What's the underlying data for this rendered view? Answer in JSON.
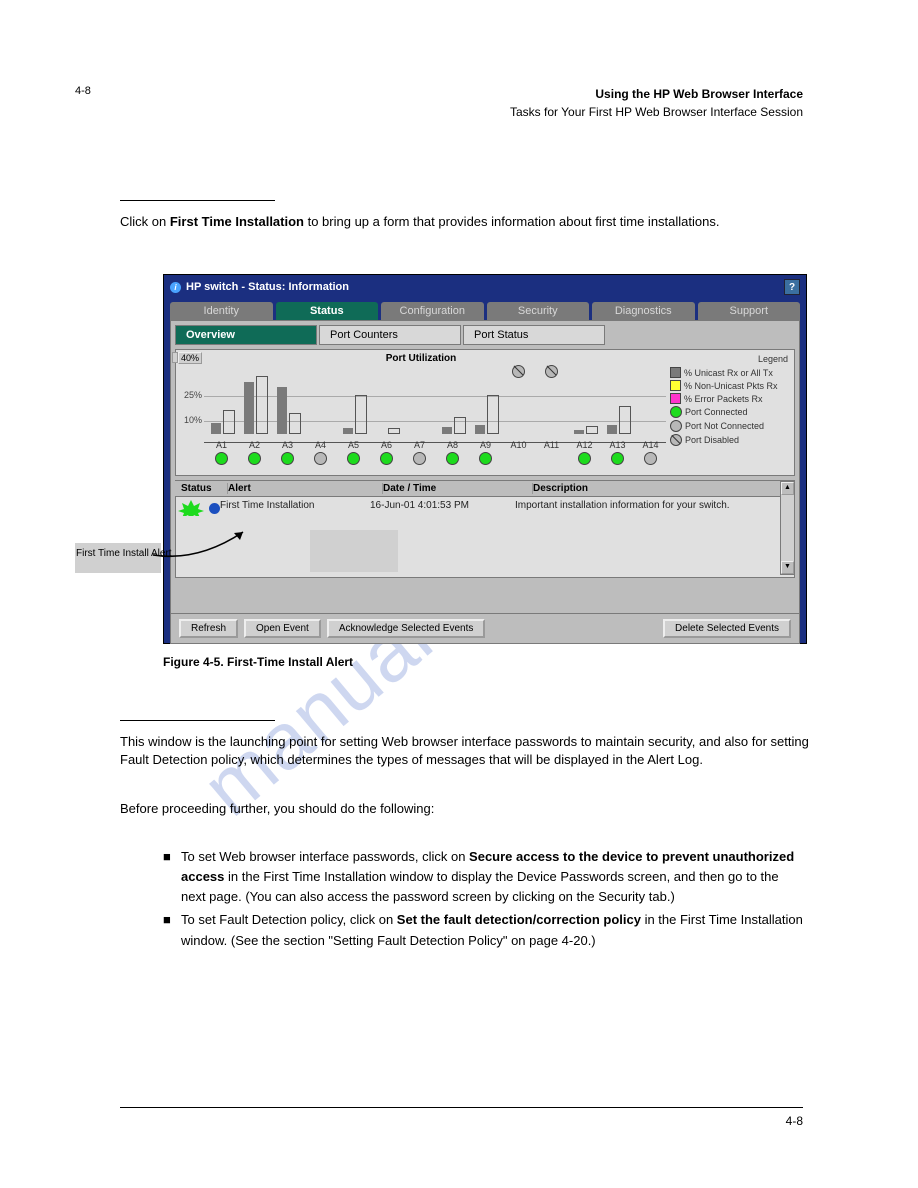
{
  "page": {
    "top_number": "4-8",
    "header_title": "Using the HP Web Browser Interface",
    "header_subtitle": "Tasks for Your First HP Web Browser Interface Session",
    "watermark": "manualshive.com"
  },
  "body": {
    "intro_pre": "Click on ",
    "intro_bold": "First Time Installation",
    "intro_post": " to bring up a form that provides information about first time installations.",
    "text2_pre": "This window is the launching point for setting Web browser interface passwords to maintain security, and also for setting Fault Detection policy, which determines the types of messages that will be displayed in the ",
    "text2_link": "Alert Log",
    "text2_post": ".",
    "text3_pre": "Before proceeding further, you should do the following:",
    "bullets": [
      {
        "prefix": "To set Web browser interface passwords, click on ",
        "bold": "Secure access to the device to prevent unauthorized access",
        "suffix": " in the First Time Installation window to display the Device Passwords screen, and then go to the next page. (You can also access the password screen by clicking on the Security tab.)"
      },
      {
        "prefix": "To set Fault Detection policy, click on ",
        "bold": "Set the fault detection/correction policy",
        "suffix": " in the First Time Installation window. (See the section \"Setting Fault Detection Policy\" on page 4-20.)"
      }
    ]
  },
  "callouts": {
    "first_time": "First Time Install Alert"
  },
  "figure": {
    "caption": "Figure 4-5. First-Time Install Alert"
  },
  "footer": {
    "page_num": "4-8"
  },
  "app": {
    "window_title": "HP switch - Status: Information",
    "tabs": [
      "Identity",
      "Status",
      "Configuration",
      "Security",
      "Diagnostics",
      "Support"
    ],
    "active_tab": 1,
    "sub_tabs": [
      "Overview",
      "Port Counters",
      "Port Status"
    ],
    "active_sub_tab": 0,
    "buttons": {
      "refresh": "Refresh",
      "open_event": "Open Event",
      "ack": "Acknowledge Selected Events",
      "delete": "Delete Selected Events"
    },
    "alert_columns": {
      "status": "Status",
      "alert": "Alert",
      "datetime": "Date / Time",
      "description": "Description"
    },
    "alert_row": {
      "badge": "NEW",
      "alert": "First Time Installation",
      "datetime": "16-Jun-01 4:01:53 PM",
      "description": "Important installation information for your switch."
    }
  },
  "chart_data": {
    "type": "bar",
    "title": "Port Utilization",
    "ylim": [
      0,
      40
    ],
    "y_ticks": [
      "40%",
      "25%",
      "10%"
    ],
    "y_button": "40%",
    "legend": {
      "title": "Legend",
      "items": [
        {
          "swatch": "#7a7a7a",
          "shape": "square",
          "label": "% Unicast Rx or All Tx"
        },
        {
          "swatch": "#ffff33",
          "shape": "square",
          "label": "% Non-Unicast Pkts Rx"
        },
        {
          "swatch": "#ff33cc",
          "shape": "square",
          "label": "% Error Packets Rx"
        },
        {
          "swatch": "#1ddb1d",
          "shape": "circle",
          "label": "Port Connected"
        },
        {
          "swatch": "#b8b8b8",
          "shape": "circle",
          "label": "Port Not Connected"
        },
        {
          "swatch": "#b8b8b8",
          "shape": "circle-slash",
          "label": "Port Disabled"
        }
      ]
    },
    "ports": [
      {
        "name": "A1",
        "gray": 6,
        "outline": 12,
        "led": "green"
      },
      {
        "name": "A2",
        "gray": 28,
        "outline": 30,
        "led": "green"
      },
      {
        "name": "A3",
        "gray": 25,
        "outline": 10,
        "led": "green"
      },
      {
        "name": "A4",
        "gray": 0,
        "outline": 0,
        "led": "gray"
      },
      {
        "name": "A5",
        "gray": 3,
        "outline": 20,
        "led": "green"
      },
      {
        "name": "A6",
        "gray": 0,
        "outline": 2,
        "led": "green"
      },
      {
        "name": "A7",
        "gray": 0,
        "outline": 0,
        "led": "gray"
      },
      {
        "name": "A8",
        "gray": 4,
        "outline": 8,
        "led": "green"
      },
      {
        "name": "A9",
        "gray": 5,
        "outline": 20,
        "led": "green"
      },
      {
        "name": "A10",
        "gray": 0,
        "outline": 0,
        "led": "disabled"
      },
      {
        "name": "A11",
        "gray": 0,
        "outline": 0,
        "led": "disabled"
      },
      {
        "name": "A12",
        "gray": 2,
        "outline": 3,
        "led": "green"
      },
      {
        "name": "A13",
        "gray": 5,
        "outline": 14,
        "led": "green"
      },
      {
        "name": "A14",
        "gray": 0,
        "outline": 0,
        "led": "gray"
      }
    ]
  }
}
